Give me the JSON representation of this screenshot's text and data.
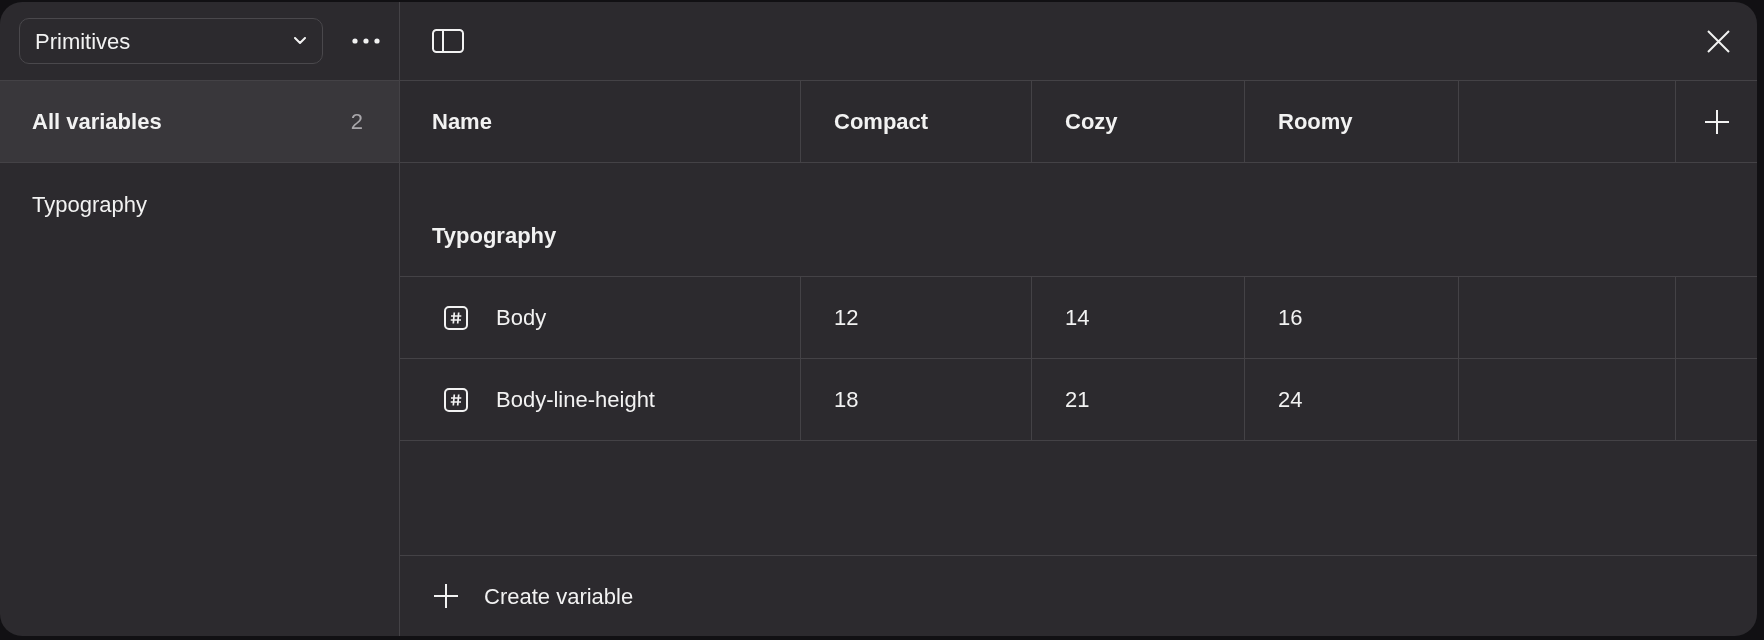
{
  "sidebar": {
    "collection_dropdown": {
      "value": "Primitives"
    },
    "items": [
      {
        "label": "All variables",
        "count": "2",
        "selected": true
      },
      {
        "label": "Typography",
        "selected": false
      }
    ]
  },
  "table": {
    "columns": [
      "Name",
      "Compact",
      "Cozy",
      "Roomy"
    ],
    "groups": [
      {
        "title": "Typography",
        "rows": [
          {
            "name": "Body",
            "values": [
              "12",
              "14",
              "16"
            ]
          },
          {
            "name": "Body-line-height",
            "values": [
              "18",
              "21",
              "24"
            ]
          }
        ]
      }
    ]
  },
  "footer": {
    "create_button": "Create variable"
  }
}
